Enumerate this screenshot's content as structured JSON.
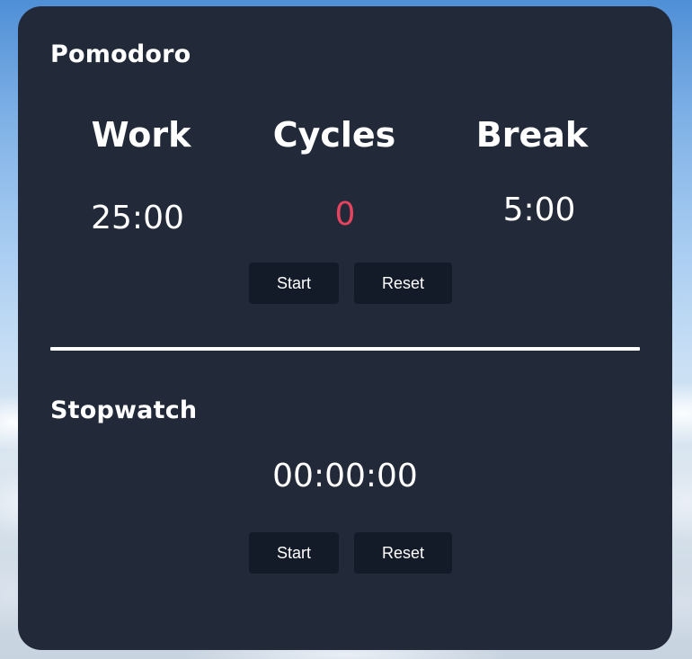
{
  "pomodoro": {
    "title": "Pomodoro",
    "work_label": "Work",
    "work_value": "25:00",
    "cycles_label": "Cycles",
    "cycles_value": "0",
    "break_label": "Break",
    "break_value": "5:00",
    "start_label": "Start",
    "reset_label": "Reset"
  },
  "stopwatch": {
    "title": "Stopwatch",
    "time": "00:00:00",
    "start_label": "Start",
    "reset_label": "Reset"
  },
  "colors": {
    "card_background": "#222a3a",
    "button_background": "#131a28",
    "cycles_accent": "#e8435e",
    "text": "#ffffff"
  }
}
